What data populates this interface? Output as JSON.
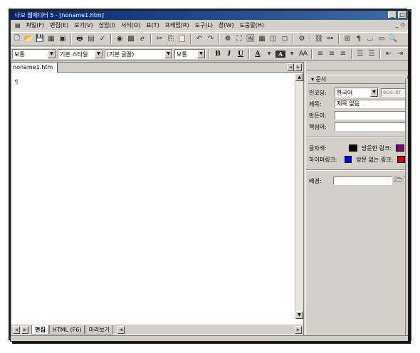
{
  "window": {
    "title": "나모 웹에디터 5 - [noname1.htm]"
  },
  "menu": [
    "파일(F)",
    "편집(E)",
    "보기(V)",
    "삽입(I)",
    "서식(O)",
    "표(T)",
    "프레임(R)",
    "도구(L)",
    "창(W)",
    "도움말(H)"
  ],
  "format_bar": {
    "paragraph_style": "보통",
    "text_style": "기본 스타일",
    "font": "(기본 글꼴)",
    "size": "보통",
    "bold": "B",
    "italic": "I",
    "underline": "U",
    "font_color": "A",
    "highlight": "A"
  },
  "document": {
    "tab": "noname1.htm",
    "pilcrow": "¶"
  },
  "mode_tabs": [
    "편집",
    "HTML (F6)",
    "미리보기"
  ],
  "panel": {
    "title": "문서",
    "encoding_label": "인코딩:",
    "encoding_value": "한국어",
    "encoding_code": "euc-kr",
    "title_label": "제목:",
    "title_value": "제목 없음",
    "author_label": "만든이:",
    "keywords_label": "핵심어:",
    "text_color_label": "글자색:",
    "visited_link_label": "방문한 링크:",
    "link_label": "하이퍼링크:",
    "active_link_label": "방문 없는 링크:",
    "background_label": "배경:",
    "colors": {
      "text": "#000000",
      "visited": "#800080",
      "link": "#0000ff",
      "active": "#cc0000"
    }
  }
}
